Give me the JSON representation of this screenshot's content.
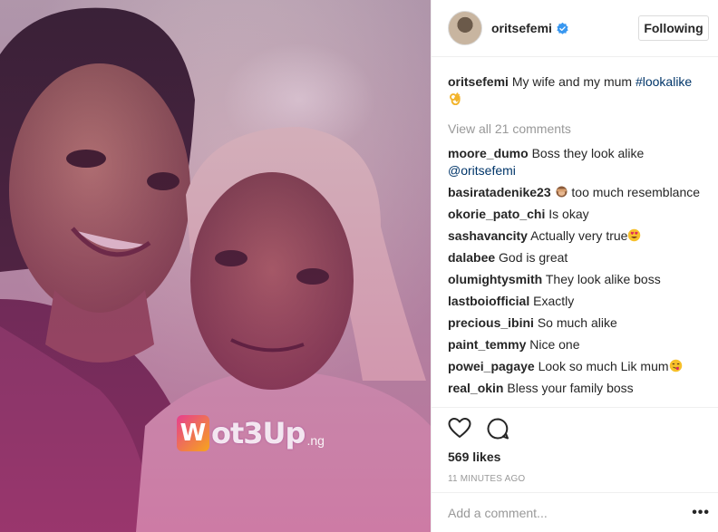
{
  "header": {
    "username": "oritsefemi",
    "follow_label": "Following"
  },
  "caption": {
    "username": "oritsefemi",
    "text": "My wife and my mum ",
    "hashtag": "#lookalike",
    "emoji": "ok-hand-emoji"
  },
  "view_all": "View all 21 comments",
  "comments": [
    {
      "user": "moore_dumo",
      "text": "Boss they look alike ",
      "mention": "@oritsefemi"
    },
    {
      "user": "basiratadenike23",
      "text": " too much resemblance",
      "emoji": "see-no-evil-monkey-emoji"
    },
    {
      "user": "okorie_pato_chi",
      "text": "Is okay"
    },
    {
      "user": "sashavancity",
      "text": "Actually very true",
      "emoji": "heart-eyes-emoji"
    },
    {
      "user": "dalabee",
      "text": "God is great"
    },
    {
      "user": "olumightysmith",
      "text": "They look alike boss"
    },
    {
      "user": "lastboiofficial",
      "text": "Exactly"
    },
    {
      "user": "precious_ibini",
      "text": "So much alike"
    },
    {
      "user": "paint_temmy",
      "text": "Nice one"
    },
    {
      "user": "powei_pagaye",
      "text": "Look so much Lik mum",
      "emoji": "face-savoring-emoji"
    },
    {
      "user": "real_okin",
      "text": "Bless your family boss"
    }
  ],
  "likes": "569 likes",
  "timestamp": "11 MINUTES AGO",
  "add_comment": {
    "placeholder": "Add a comment..."
  },
  "more_label": "•••",
  "watermark": {
    "letter": "W",
    "text": "ot3Up",
    "suffix": ".ng"
  },
  "colors": {
    "link": "#003569",
    "muted": "#999999",
    "verified": "#3897f0",
    "border": "#efefef"
  }
}
